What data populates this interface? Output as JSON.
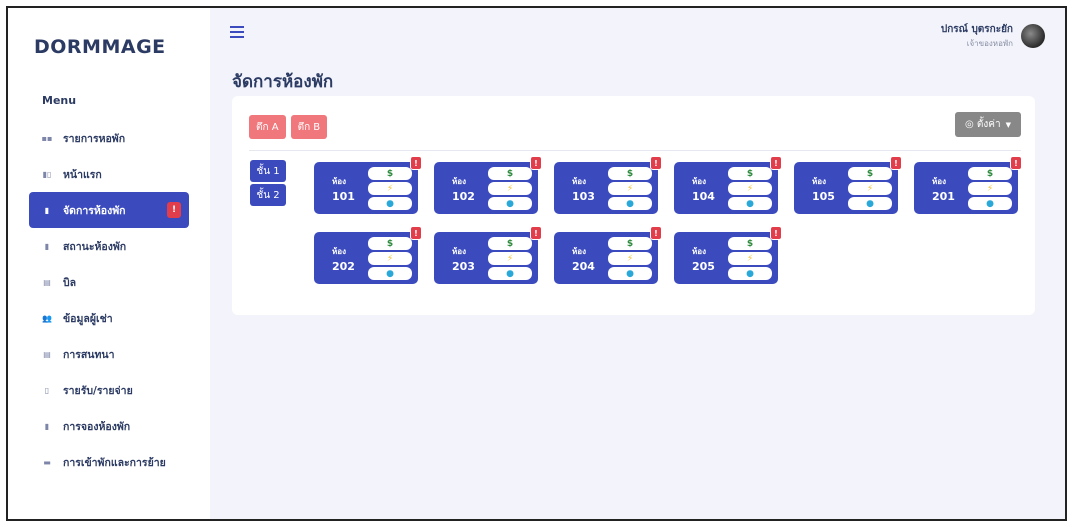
{
  "app": {
    "brand": "DORMMAGE"
  },
  "sidebar": {
    "heading": "Menu",
    "items": [
      {
        "label": "รายการหอพัก",
        "icon": "grid-icon",
        "active": false,
        "badge": ""
      },
      {
        "label": "หน้าแรก",
        "icon": "layout-icon",
        "active": false,
        "badge": ""
      },
      {
        "label": "จัดการห้องพัก",
        "icon": "door-icon",
        "active": true,
        "badge": "!"
      },
      {
        "label": "สถานะห้องพัก",
        "icon": "status-icon",
        "active": false,
        "badge": ""
      },
      {
        "label": "บิล",
        "icon": "bill-icon",
        "active": false,
        "badge": ""
      },
      {
        "label": "ข้อมูลผู้เช่า",
        "icon": "users-icon",
        "active": false,
        "badge": ""
      },
      {
        "label": "การสนทนา",
        "icon": "chat-icon",
        "active": false,
        "badge": ""
      },
      {
        "label": "รายรับ/รายจ่าย",
        "icon": "document-icon",
        "active": false,
        "badge": ""
      },
      {
        "label": "การจองห้องพัก",
        "icon": "booking-icon",
        "active": false,
        "badge": ""
      },
      {
        "label": "การเข้าพักและการย้าย",
        "icon": "move-icon",
        "active": false,
        "badge": ""
      }
    ]
  },
  "header": {
    "user_name": "ปกรณ์ บุตรกะยัก",
    "user_role": "เจ้าของหอพัก"
  },
  "main": {
    "title": "จัดการห้องพัก",
    "buildings": [
      "ตึก A",
      "ตึก B"
    ],
    "settings_label": "◎ ตั้งค่า",
    "floors": [
      "ชั้น 1",
      "ชั้น 2"
    ],
    "room_prefix": "ห้อง",
    "rooms_row1": [
      "101",
      "102",
      "103",
      "104",
      "105",
      "201"
    ],
    "rooms_row2": [
      "202",
      "203",
      "204",
      "205"
    ],
    "util_symbols": {
      "money": "$",
      "electric": "⚡",
      "water": "●"
    },
    "alert_symbol": "!"
  },
  "colors": {
    "primary": "#3b4bbd",
    "building_button": "#f0777c",
    "alert": "#e23d4b",
    "settings": "#888888"
  }
}
